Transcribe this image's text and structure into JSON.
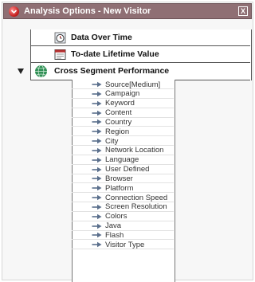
{
  "window": {
    "title": "Analysis Options - New Visitor",
    "close_label": "X"
  },
  "options": [
    {
      "label": "Data Over Time",
      "icon": "clock-icon"
    },
    {
      "label": "To-date Lifetime Value",
      "icon": "calendar-icon"
    },
    {
      "label": "Cross Segment Performance",
      "icon": "globe-icon"
    }
  ],
  "segments": [
    "Source[Medium]",
    "Campaign",
    "Keyword",
    "Content",
    "Country",
    "Region",
    "City",
    "Network Location",
    "Language",
    "User Defined",
    "Browser",
    "Platform",
    "Connection Speed",
    "Screen Resolution",
    "Colors",
    "Java",
    "Flash",
    "Visitor Type"
  ],
  "colors": {
    "titlebar": "#8f6f74",
    "title_text": "#ffffff",
    "arrow": "#5a6f8c"
  }
}
